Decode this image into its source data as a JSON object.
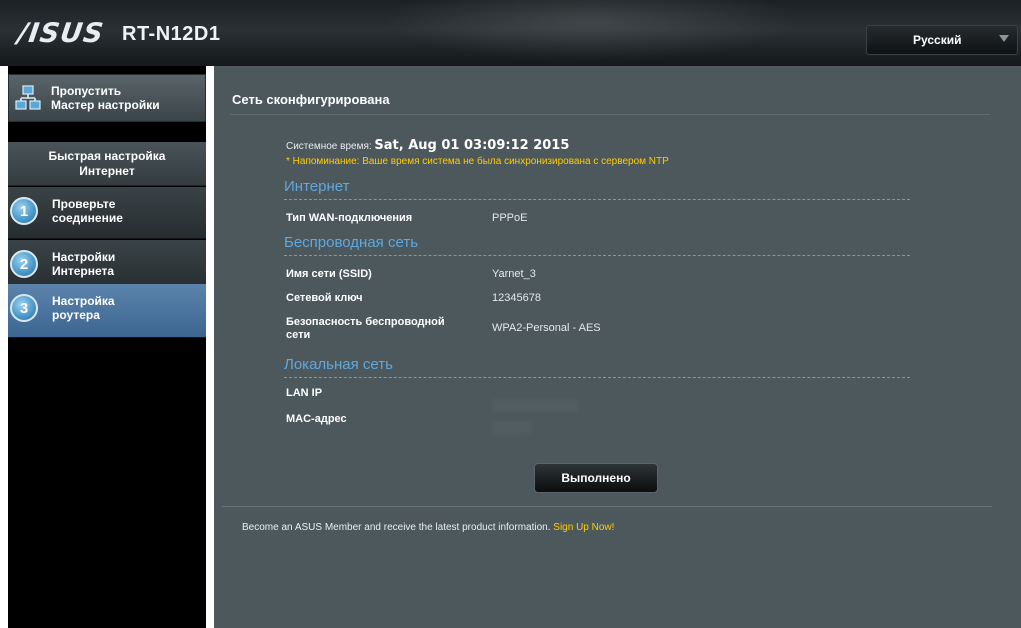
{
  "header": {
    "brand": "/ISUS",
    "model": "RT-N12D1",
    "language": "Русский"
  },
  "sidebar": {
    "skip_wizard": "Пропустить\nМастер настройки",
    "quick_setup_title": "Быстрая настройка\nИнтернет",
    "steps": [
      {
        "number": "1",
        "label": "Проверьте\nсоединение",
        "active": false
      },
      {
        "number": "2",
        "label": "Настройки\nИнтернета",
        "active": false
      },
      {
        "number": "3",
        "label": "Настройка\nроутера",
        "active": true
      }
    ]
  },
  "main": {
    "title": "Сеть сконфигурирована",
    "system_time_label": "Системное время:",
    "system_time_value": "Sat, Aug 01 03:09:12 2015",
    "ntp_warning": "* Напоминание: Ваше время система не была синхронизирована с сервером NTP",
    "sections": {
      "internet": {
        "title": "Интернет",
        "wan_type_label": "Тип WAN-подключения",
        "wan_type_value": "PPPoE"
      },
      "wireless": {
        "title": "Беспроводная сеть",
        "ssid_label": "Имя сети (SSID)",
        "ssid_value": "Yarnet_3",
        "key_label": "Сетевой ключ",
        "key_value": "12345678",
        "security_label": "Безопасность беспроводной\nсети",
        "security_value": "WPA2-Personal - AES"
      },
      "lan": {
        "title": "Локальная сеть",
        "lan_ip_label": "LAN IP",
        "mac_label": "MAC-адрес"
      }
    },
    "done_button": "Выполнено",
    "member_text": "Become an ASUS Member and receive the latest product information.",
    "signup_link": "Sign Up Now!"
  },
  "colors": {
    "accent_blue": "#5fa8dc",
    "warning_yellow": "#ffcc00",
    "active_step": "#4a74a0",
    "content_bg": "#4d585d"
  }
}
